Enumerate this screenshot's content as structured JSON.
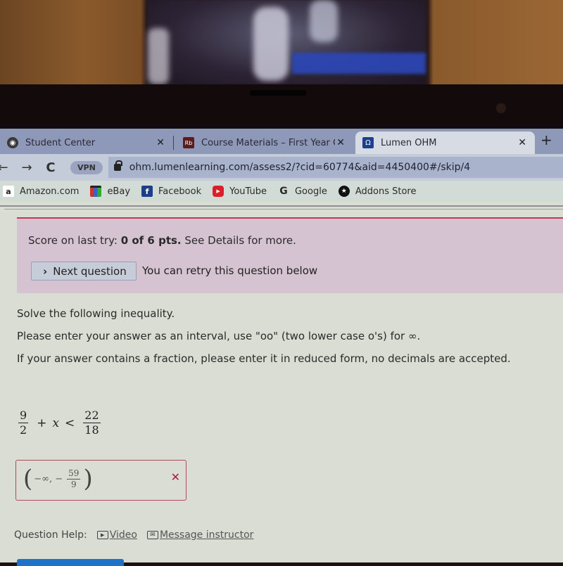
{
  "browser": {
    "tabs": [
      {
        "label": "Student Center",
        "favicon": "globe-icon",
        "active": false
      },
      {
        "label": "Course Materials – First Year Colle",
        "favicon": "rb-icon",
        "favicon_text": "Rb",
        "active": false
      },
      {
        "label": "Lumen OHM",
        "favicon": "omega-icon",
        "favicon_text": "Ω",
        "active": true
      }
    ],
    "new_tab_label": "+",
    "close_glyph": "✕",
    "nav": {
      "back": "←",
      "forward": "→",
      "reload": "C"
    },
    "vpn_label": "VPN",
    "url": "ohm.lumenlearning.com/assess2/?cid=60774&aid=4450400#/skip/4",
    "bookmarks": [
      {
        "label": "Amazon.com",
        "icon": "amazon-icon",
        "icon_text": "a",
        "color": "#222222"
      },
      {
        "label": "eBay",
        "icon": "ebay-icon",
        "icon_text": "",
        "color": "#333333"
      },
      {
        "label": "Facebook",
        "icon": "facebook-icon",
        "icon_text": "f",
        "color": "#1d3e8a"
      },
      {
        "label": "YouTube",
        "icon": "youtube-icon",
        "icon_text": "▶",
        "color": "#d81f2a"
      },
      {
        "label": "Google",
        "icon": "google-icon",
        "icon_text": "G",
        "color": "#2a2a2a"
      },
      {
        "label": "Addons Store",
        "icon": "addons-icon",
        "icon_text": "★",
        "color": "#111111"
      }
    ]
  },
  "score_panel": {
    "prefix": "Score on last try: ",
    "score": "0 of 6 pts.",
    "suffix": " See Details for more.",
    "next_button": "Next question",
    "next_chevron": "›",
    "retry_text": "You can retry this question below",
    "accent_color": "#c0394f"
  },
  "question": {
    "line1": "Solve the following inequality.",
    "line2": "Please enter your answer as an interval, use \"oo\" (two lower case o's) for ∞.",
    "line3": "If your answer contains a fraction, please enter it in reduced form, no decimals are accepted.",
    "equation": {
      "lhs_num": "9",
      "lhs_den": "2",
      "plus": "+",
      "variable": "x",
      "relation": "<",
      "rhs_num": "22",
      "rhs_den": "18"
    }
  },
  "answer": {
    "open_paren": "(",
    "left": "−∞, −",
    "frac_num": "59",
    "frac_den": "9",
    "close_paren": ")",
    "status_glyph": "✕",
    "status": "incorrect"
  },
  "help": {
    "label": "Question Help:",
    "video": "Video",
    "message": "Message instructor"
  }
}
